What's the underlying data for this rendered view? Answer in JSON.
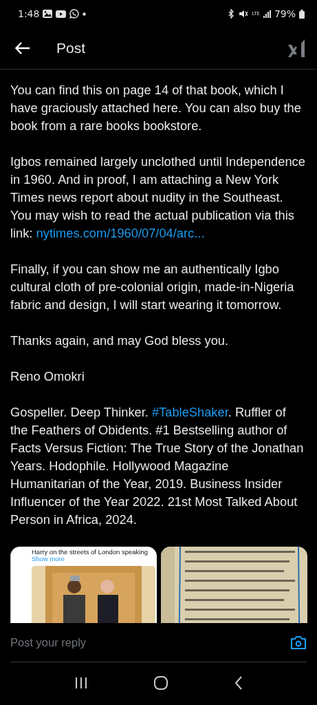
{
  "status_bar": {
    "time": "1:48",
    "network": "LTE",
    "battery": "79%"
  },
  "header": {
    "title": "Post"
  },
  "paragraphs": [
    {
      "segments": [
        {
          "kind": "text",
          "text": "You can find this on page 14 of that book, which I have graciously attached here. You can also buy the book from a rare books bookstore."
        }
      ]
    },
    {
      "segments": [
        {
          "kind": "text",
          "text": "Igbos remained largely unclothed until Independence in 1960. And in proof, I am attaching a New York Times news report about nudity in the Southeast. You may wish to read the actual publication via this link: "
        },
        {
          "kind": "link",
          "text": "nytimes.com/1960/07/04/arc..."
        }
      ]
    },
    {
      "segments": [
        {
          "kind": "text",
          "text": "Finally, if you can show me an authentically Igbo cultural cloth of pre-colonial origin, made-in-Nigeria fabric and design, I will start wearing it tomorrow."
        }
      ]
    },
    {
      "segments": [
        {
          "kind": "text",
          "text": "Thanks again, and may God bless you."
        }
      ]
    },
    {
      "segments": [
        {
          "kind": "text",
          "text": "Reno Omokri"
        }
      ]
    },
    {
      "segments": [
        {
          "kind": "text",
          "text": "Gospeller. Deep Thinker. "
        },
        {
          "kind": "link",
          "text": "#TableShaker"
        },
        {
          "kind": "text",
          "text": ". Ruffler of the Feathers of Obidents. #1 Bestselling author of Facts Versus Fiction: The True Story of the Jonathan Years. Hodophile. Hollywood Magazine Humanitarian of the Year, 2019. Business Insider Influencer of the Year 2022. 21st Most Talked About Person in Africa, 2024."
        }
      ]
    }
  ],
  "media": [
    {
      "kind": "screenshot",
      "caption": "Harry on the streets of London speaking",
      "more": "Show more"
    },
    {
      "kind": "picture"
    }
  ],
  "reply": {
    "placeholder": "Post your reply"
  }
}
